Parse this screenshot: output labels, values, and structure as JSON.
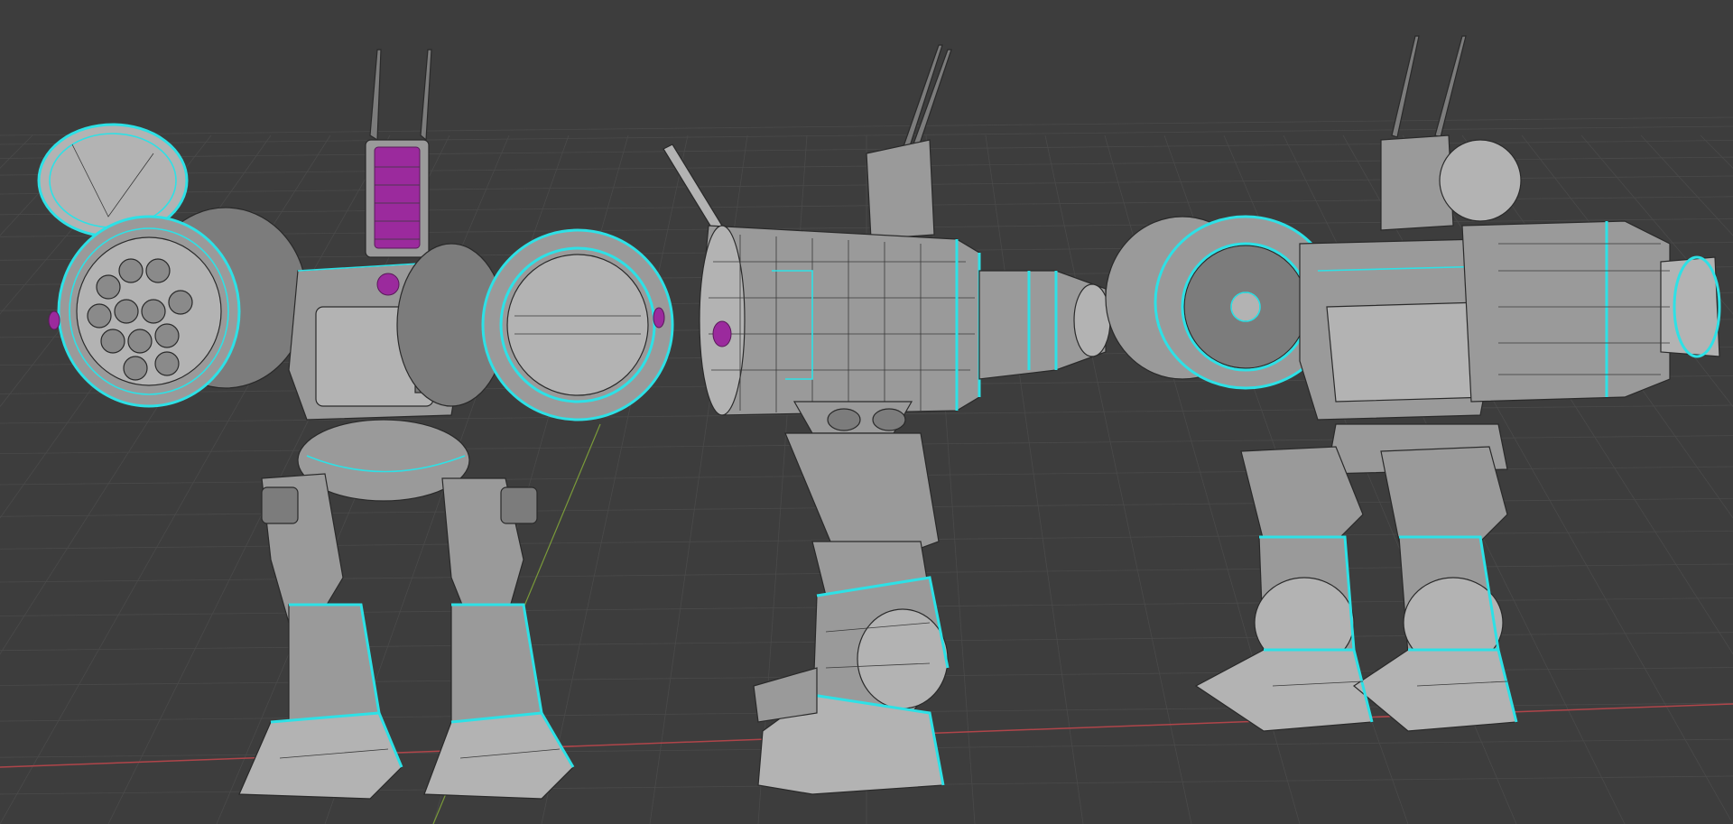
{
  "viewport": {
    "type": "3d-viewport",
    "background_color": "#3d3d3d",
    "grid_color": "#4a4a4a",
    "x_axis_color": "#b0454a",
    "y_axis_color": "#7a9a3a"
  },
  "scene": {
    "objects": [
      {
        "name": "mech-front-view",
        "view": "front"
      },
      {
        "name": "mech-side-view",
        "view": "side"
      },
      {
        "name": "mech-back-three-quarter-view",
        "view": "back-three-quarter"
      }
    ],
    "colors": {
      "mesh_base": "#9a9a9a",
      "uv_seams": "#2de1e6",
      "selected_faces": "#9b2a9d"
    }
  }
}
